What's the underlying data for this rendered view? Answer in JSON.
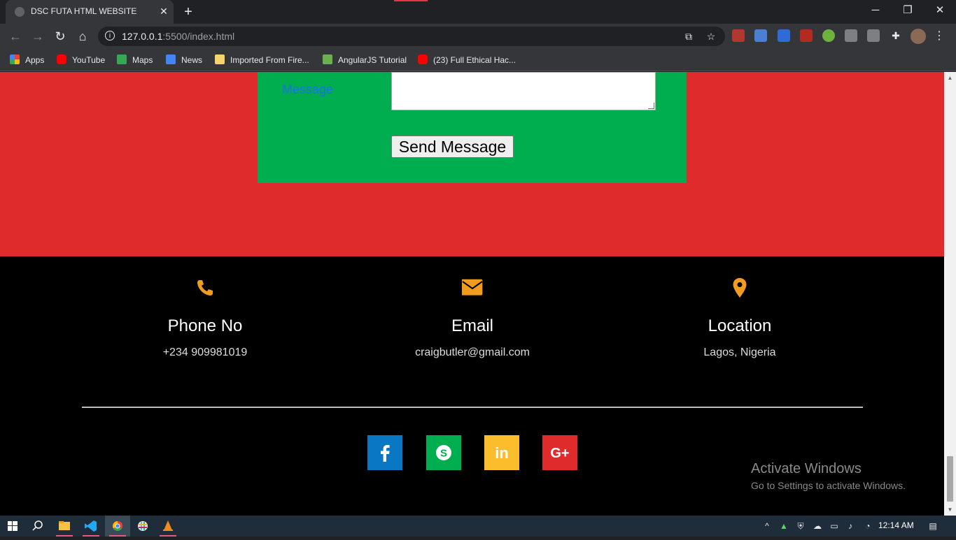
{
  "browser": {
    "tab_title": "DSC FUTA HTML WEBSITE",
    "tab_close": "✕",
    "new_tab": "+",
    "url_host": "127.0.0.1",
    "url_path": ":5500/index.html",
    "window_controls": {
      "minimize": "─",
      "restore": "❐",
      "close": "✕"
    },
    "bookmarks": [
      {
        "label": "Apps",
        "icon": "apps-grid-icon",
        "color": "#ea4335"
      },
      {
        "label": "YouTube",
        "icon": "youtube-icon",
        "color": "#ff0000"
      },
      {
        "label": "Maps",
        "icon": "maps-icon",
        "color": "#34a853"
      },
      {
        "label": "News",
        "icon": "news-icon",
        "color": "#4285f4"
      },
      {
        "label": "Imported From Fire...",
        "icon": "folder-icon",
        "color": "#f6d36b"
      },
      {
        "label": "AngularJS Tutorial",
        "icon": "angularjs-icon",
        "color": "#6ab04c"
      },
      {
        "label": "(23) Full Ethical Hac...",
        "icon": "youtube-icon",
        "color": "#ff0000"
      }
    ]
  },
  "page": {
    "form": {
      "message_label": "Message",
      "send_button": "Send Message"
    },
    "footer": {
      "contacts": [
        {
          "title": "Phone No",
          "value": "+234 909981019",
          "icon": "phone-icon"
        },
        {
          "title": "Email",
          "value": "craigbutler@gmail.com",
          "icon": "envelope-icon"
        },
        {
          "title": "Location",
          "value": "Lagos, Nigeria",
          "icon": "map-marker-icon"
        }
      ],
      "social": [
        {
          "icon": "facebook-icon",
          "glyph": "f",
          "color": "#0a77c4"
        },
        {
          "icon": "skype-icon",
          "glyph": "S",
          "color": "#00ad4f"
        },
        {
          "icon": "linkedin-icon",
          "glyph": "in",
          "color": "#fbbd2b"
        },
        {
          "icon": "google-plus-icon",
          "glyph": "G+",
          "color": "#df2b2b"
        }
      ]
    },
    "watermark": {
      "title": "Activate Windows",
      "subtitle": "Go to Settings to activate Windows."
    }
  },
  "colors": {
    "red_section": "#df2b2b",
    "form_green": "#00ad4f",
    "icon_orange": "#f29c1f"
  },
  "taskbar": {
    "time": "12:14 AM"
  }
}
